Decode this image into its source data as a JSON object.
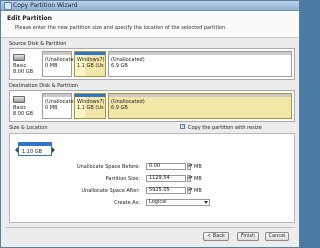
{
  "window": {
    "title": "Copy Partition Wizard"
  },
  "header": {
    "title": "Edit Partition",
    "subtitle": "Please enter the new partition size and specify the location of the selected partition."
  },
  "source": {
    "label": "Source Disk & Partition",
    "disk": {
      "type": "Basic",
      "size": "8.00 GB"
    },
    "segments": [
      {
        "name": "(Unallocated)",
        "size": "0 MB"
      },
      {
        "name": "Windows7(",
        "size": "1.1 GB (Us"
      },
      {
        "name": "(Unallocated)",
        "size": "6.9 GB"
      }
    ]
  },
  "destination": {
    "label": "Destination Disk & Partition",
    "disk": {
      "type": "Basic",
      "size": "8.00 GB"
    },
    "segments": [
      {
        "name": "(Unallocated)",
        "size": "0 MB"
      },
      {
        "name": "Windows7(",
        "size": "1.1 GB (Us"
      },
      {
        "name": "(Unallocated)",
        "size": "6.9 GB"
      }
    ]
  },
  "size_location": {
    "label": "Size & Location",
    "copy_with_resize": {
      "label": "Copy the partition with resize",
      "checked": true
    },
    "handle_label": "1.10 GB",
    "fields": {
      "before": {
        "label": "Unallocate Space Before:",
        "value": "0.00",
        "unit": "MB"
      },
      "size": {
        "label": "Partition Size:",
        "value": "1129.54",
        "unit": "MB"
      },
      "after": {
        "label": "Unallocate Space After:",
        "value": "5925.05",
        "unit": "MB"
      },
      "create_as": {
        "label": "Create As:",
        "value": "Logical"
      }
    }
  },
  "buttons": {
    "back": "< Back",
    "finish": "Finish",
    "cancel": "Cancel"
  },
  "colors": {
    "partition_bar": "#2f76c8",
    "selected_fill": "#f2e6a8"
  }
}
